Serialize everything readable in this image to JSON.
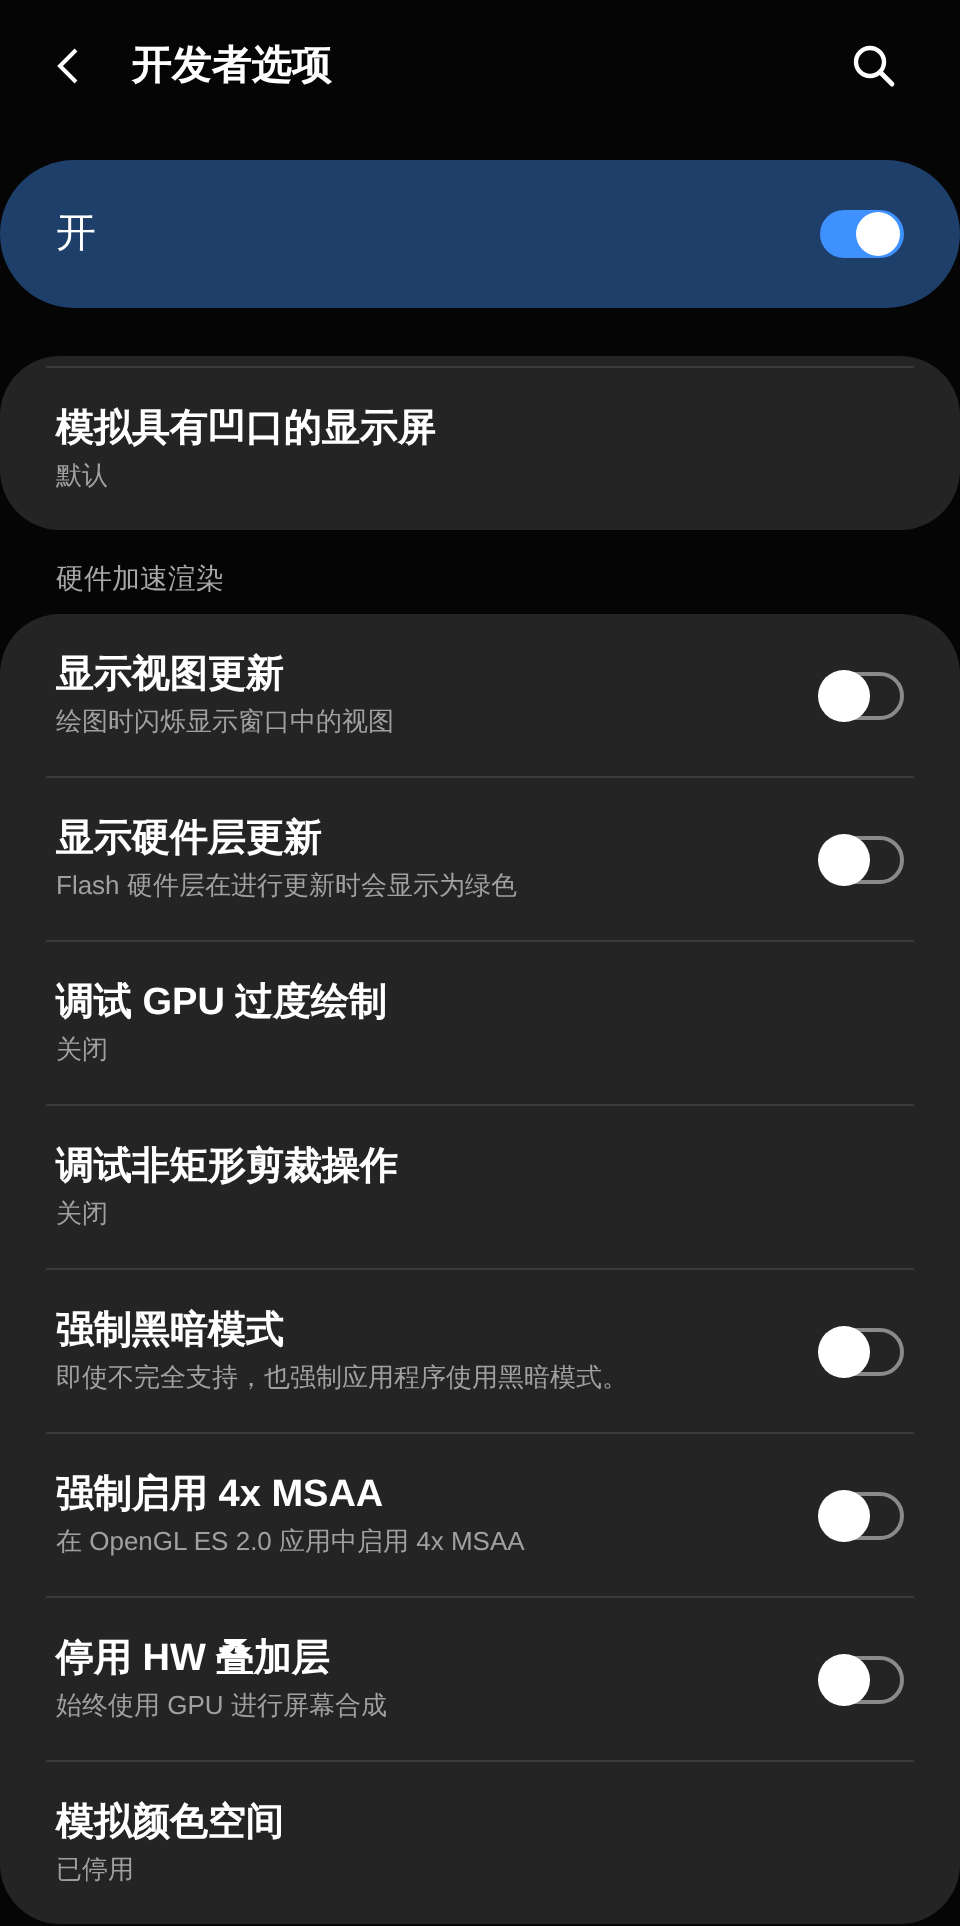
{
  "header": {
    "title": "开发者选项"
  },
  "master": {
    "label": "开",
    "on": true
  },
  "top_card": {
    "items": [
      {
        "kind": "plain",
        "title": "模拟具有凹口的显示屏",
        "subtitle": "默认"
      }
    ]
  },
  "section": {
    "title": "硬件加速渲染",
    "items": [
      {
        "kind": "toggle",
        "title": "显示视图更新",
        "subtitle": "绘图时闪烁显示窗口中的视图",
        "on": false
      },
      {
        "kind": "toggle",
        "title": "显示硬件层更新",
        "subtitle": "Flash 硬件层在进行更新时会显示为绿色",
        "on": false
      },
      {
        "kind": "plain",
        "title": "调试 GPU 过度绘制",
        "subtitle": "关闭"
      },
      {
        "kind": "plain",
        "title": "调试非矩形剪裁操作",
        "subtitle": "关闭"
      },
      {
        "kind": "toggle",
        "title": "强制黑暗模式",
        "subtitle": "即使不完全支持，也强制应用程序使用黑暗模式。",
        "on": false
      },
      {
        "kind": "toggle",
        "title": "强制启用 4x MSAA",
        "subtitle": "在 OpenGL ES 2.0 应用中启用 4x MSAA",
        "on": false
      },
      {
        "kind": "toggle",
        "title": "停用 HW 叠加层",
        "subtitle": "始终使用 GPU 进行屏幕合成",
        "on": false
      },
      {
        "kind": "plain",
        "title": "模拟颜色空间",
        "subtitle": "已停用"
      }
    ]
  }
}
